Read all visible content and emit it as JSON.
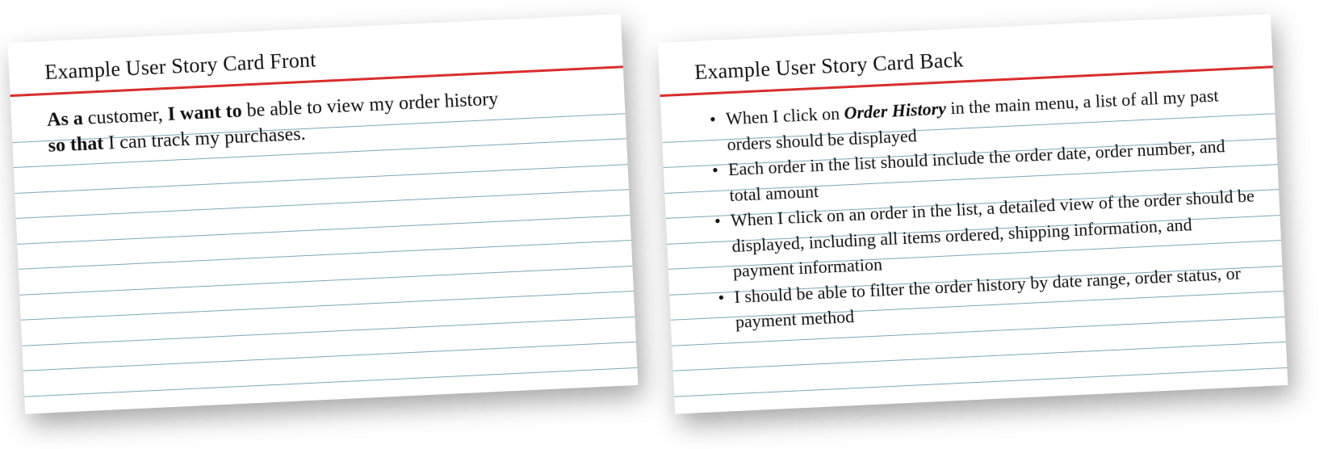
{
  "front": {
    "title": "Example User Story Card Front",
    "as_a_label": "As a",
    "as_a_value": "customer,",
    "i_want_to_label": "I want to",
    "i_want_to_value": "be able to view my order history",
    "so_that_label": "so that",
    "so_that_value": "I can track my purchases."
  },
  "back": {
    "title": "Example User Story Card Back",
    "items": [
      {
        "pre": "When I click on ",
        "em": "Order History",
        "post": " in the main menu, a list of all my past orders should be displayed"
      },
      {
        "pre": "Each order in the list should include the order date, order number, and total amount",
        "em": "",
        "post": ""
      },
      {
        "pre": "When I click on an order in the list, a detailed view of the order should be displayed, including all items ordered, shipping information, and payment information",
        "em": "",
        "post": ""
      },
      {
        "pre": "I should be able to filter the order history by date range, order status, or payment method",
        "em": "",
        "post": ""
      }
    ]
  }
}
